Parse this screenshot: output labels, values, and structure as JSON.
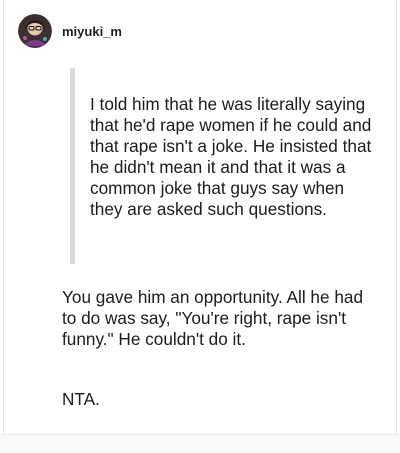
{
  "post": {
    "author": {
      "username": "miyuki_m",
      "avatar_icon": "user-avatar-icon"
    },
    "quote": "I told him that he was literally saying that he'd rape women if he could and that rape isn't a joke. He insisted that he didn't mean it and that it was a common joke that guys say when they are asked such questions.",
    "reply": "You gave him an opportunity. All he had to do was say, \"You're right, rape isn't funny.\" He couldn't do it.",
    "verdict": "NTA.",
    "colors": {
      "quote_bar": "#d9d9d9",
      "text": "#1c1c1c",
      "background": "#ffffff"
    }
  }
}
